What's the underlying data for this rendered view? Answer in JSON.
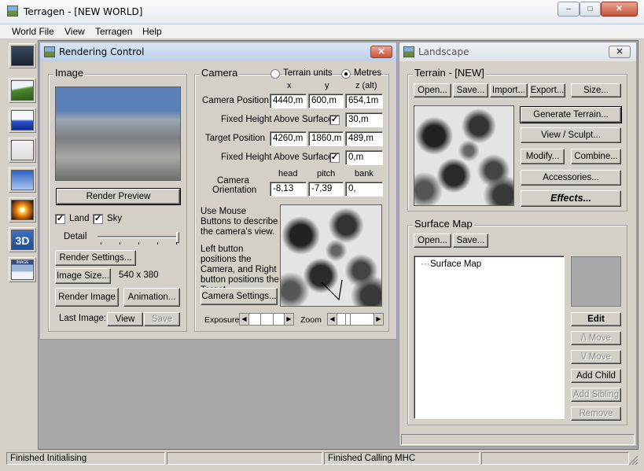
{
  "window": {
    "title": "Terragen  -  [NEW WORLD]",
    "minimize_glyph": "–",
    "maximize_glyph": "□",
    "close_glyph": "✕"
  },
  "menu": [
    "World File",
    "View",
    "Terragen",
    "Help"
  ],
  "toolbar_icons": [
    "render-control-icon",
    "landscape-icon",
    "water-icon",
    "clouds-icon",
    "sky-icon",
    "sun-icon",
    "3d-preview-icon",
    "image-window-icon"
  ],
  "toolbar_3d_label": "3D",
  "toolbar_image_label": "IMAGE",
  "rendering_control": {
    "title": "Rendering Control",
    "close_glyph": "✕",
    "image_group": {
      "label": "Image",
      "render_preview": "Render Preview",
      "land": "Land",
      "sky": "Sky",
      "detail": "Detail",
      "detail_level": 1.0,
      "render_settings": "Render Settings...",
      "image_size_btn": "Image Size...",
      "image_size_value": "540 x 380",
      "render_image": "Render Image",
      "animation": "Animation...",
      "last_image": "Last Image:",
      "view": "View",
      "save": "Save"
    },
    "camera_group": {
      "label": "Camera",
      "terrain_units": "Terrain units",
      "metres": "Metres",
      "col_x": "x",
      "col_y": "y",
      "col_z": "z (alt)",
      "camera_position": "Camera Position",
      "cam_x": "4440,m",
      "cam_y": "600,m",
      "cam_z": "654,1m",
      "fixed_height": "Fixed Height Above Surface",
      "cam_fixed_value": "30,m",
      "target_position": "Target Position",
      "tgt_x": "4260,m",
      "tgt_y": "1860,m",
      "tgt_z": "489,m",
      "tgt_fixed_value": "0,m",
      "head": "head",
      "pitch": "pitch",
      "bank": "bank",
      "orientation_line1": "Camera",
      "orientation_line2": "Orientation",
      "head_value": "-8,13",
      "pitch_value": "-7,39",
      "bank_value": "0,",
      "help1": "Use Mouse Buttons to describe the camera's view.",
      "help2": "Left button positions the Camera, and Right button positions the Target.",
      "camera_settings": "Camera Settings...",
      "exposure": "Exposure",
      "zoom": "Zoom"
    }
  },
  "landscape": {
    "title": "Landscape",
    "close_glyph": "✕",
    "terrain_group": {
      "label": "Terrain - [NEW]",
      "open": "Open...",
      "save": "Save...",
      "import": "Import...",
      "export": "Export...",
      "size": "Size...",
      "generate": "Generate Terrain...",
      "view_sculpt": "View / Sculpt...",
      "modify": "Modify...",
      "combine": "Combine...",
      "accessories": "Accessories...",
      "effects": "Effects..."
    },
    "surface_group": {
      "label": "Surface Map",
      "open": "Open...",
      "save": "Save...",
      "tree_root": "Surface Map",
      "edit": "Edit",
      "move_up": "/\\ Move",
      "move_down": "\\/ Move",
      "add_child": "Add Child",
      "add_sibling": "Add Sibling",
      "remove": "Remove"
    }
  },
  "status": [
    "Finished Initialising",
    "",
    "Finished Calling MHC",
    ""
  ]
}
